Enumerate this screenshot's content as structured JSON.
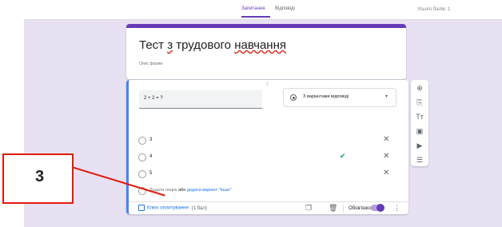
{
  "tabs": {
    "questions": "Запитання",
    "responses": "Відповіді",
    "total": "Усього балів: 1"
  },
  "form": {
    "title_a": "Тест ",
    "title_underline_1": "з",
    "title_b": " трудового ",
    "title_underline_2": "навчання",
    "description": "Опис форми"
  },
  "question": {
    "text": "2 + 2 = ?",
    "type_label": "З варіантами відповіді",
    "options": [
      "3",
      "4",
      "5"
    ],
    "add_option": "Додати опцію",
    "or": "або",
    "add_other": "додати варіант \"Інше\"",
    "answer_key": "Ключ оплитування",
    "points": "(1 бал)",
    "required": "Обов'язково"
  },
  "annotation": {
    "label": "3"
  },
  "colors": {
    "accent": "#673ab7",
    "active_border": "#4285f4",
    "link": "#1a73e8",
    "annotation": "#e01b0e",
    "canvas": "#e8e1f3"
  }
}
